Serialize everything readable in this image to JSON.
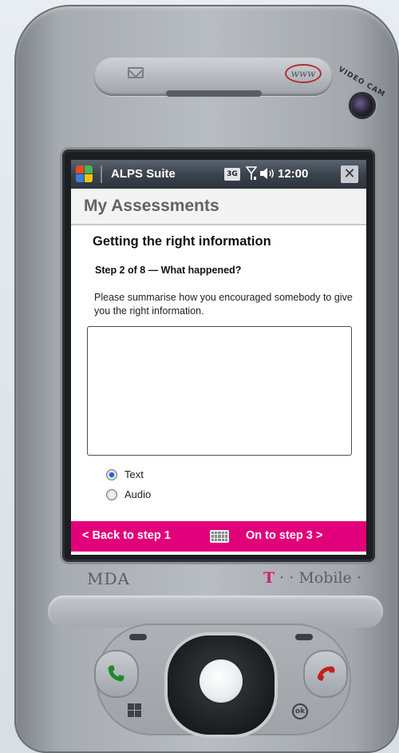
{
  "titlebar": {
    "app_title": "ALPS Suite",
    "network_badge": "3G",
    "signal_icon": "antenna-signal-icon",
    "volume_icon": "speaker-volume-icon",
    "clock": "12:00",
    "close_label": "✕"
  },
  "header": {
    "title": "My Assessments"
  },
  "form": {
    "heading": "Getting the right information",
    "step": "Step 2 of 8 — What happened?",
    "instruction": "Please summarise how you encouraged somebody to give you the right information.",
    "answer_value": "",
    "options": [
      {
        "label": "Text",
        "selected": true
      },
      {
        "label": "Audio",
        "selected": false
      }
    ]
  },
  "bottombar": {
    "back_label": "< Back to step 1",
    "next_label": "On to step 3 >",
    "keyboard_icon": "keyboard-icon",
    "color": "#e2007a"
  },
  "device": {
    "brand_left": "MDA",
    "brand_right_t": "T",
    "brand_right_rest": " · · Mobile ·",
    "www_logo": "www",
    "videocam_label": "VIDEO CAM",
    "ok_label": "ok"
  }
}
